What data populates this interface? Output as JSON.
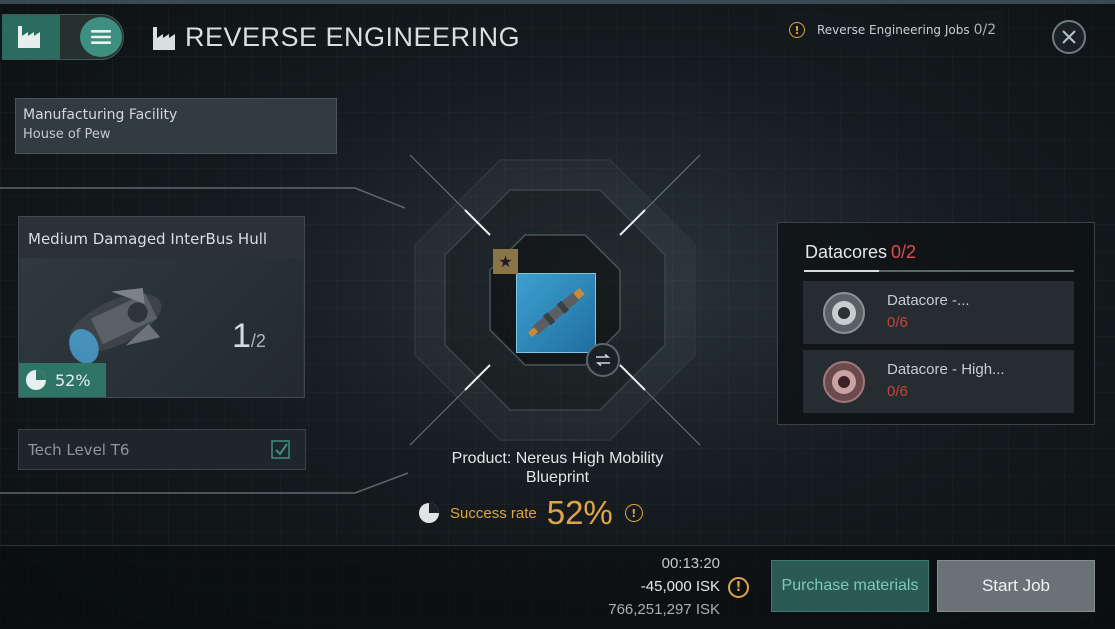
{
  "header": {
    "title": "REVERSE ENGINEERING",
    "jobs_label": "Reverse Engineering Jobs",
    "jobs_count": "0/2"
  },
  "facility": {
    "type": "Manufacturing Facility",
    "name": "House of Pew"
  },
  "input_item": {
    "name": "Medium Damaged InterBus Hull",
    "qty_have": "1",
    "qty_need": "/2",
    "percent": "52%"
  },
  "tech": {
    "label": "Tech Level T6"
  },
  "product": {
    "label": "Product: Nereus High Mobility Blueprint",
    "success_label": "Success rate",
    "success_value": "52%"
  },
  "datacores": {
    "title": "Datacores",
    "count": "0/2",
    "items": [
      {
        "name": "Datacore -...",
        "count": "0/6"
      },
      {
        "name": "Datacore - High...",
        "count": "0/6"
      }
    ]
  },
  "costs": {
    "time": "00:13:20",
    "isk": "-45,000 ISK",
    "balance": "766,251,297 ISK"
  },
  "buttons": {
    "purchase": "Purchase materials",
    "start": "Start Job"
  },
  "colors": {
    "accent_teal": "#2f7566",
    "warning_orange": "#e0a544",
    "alert_red": "#e34b4b"
  }
}
